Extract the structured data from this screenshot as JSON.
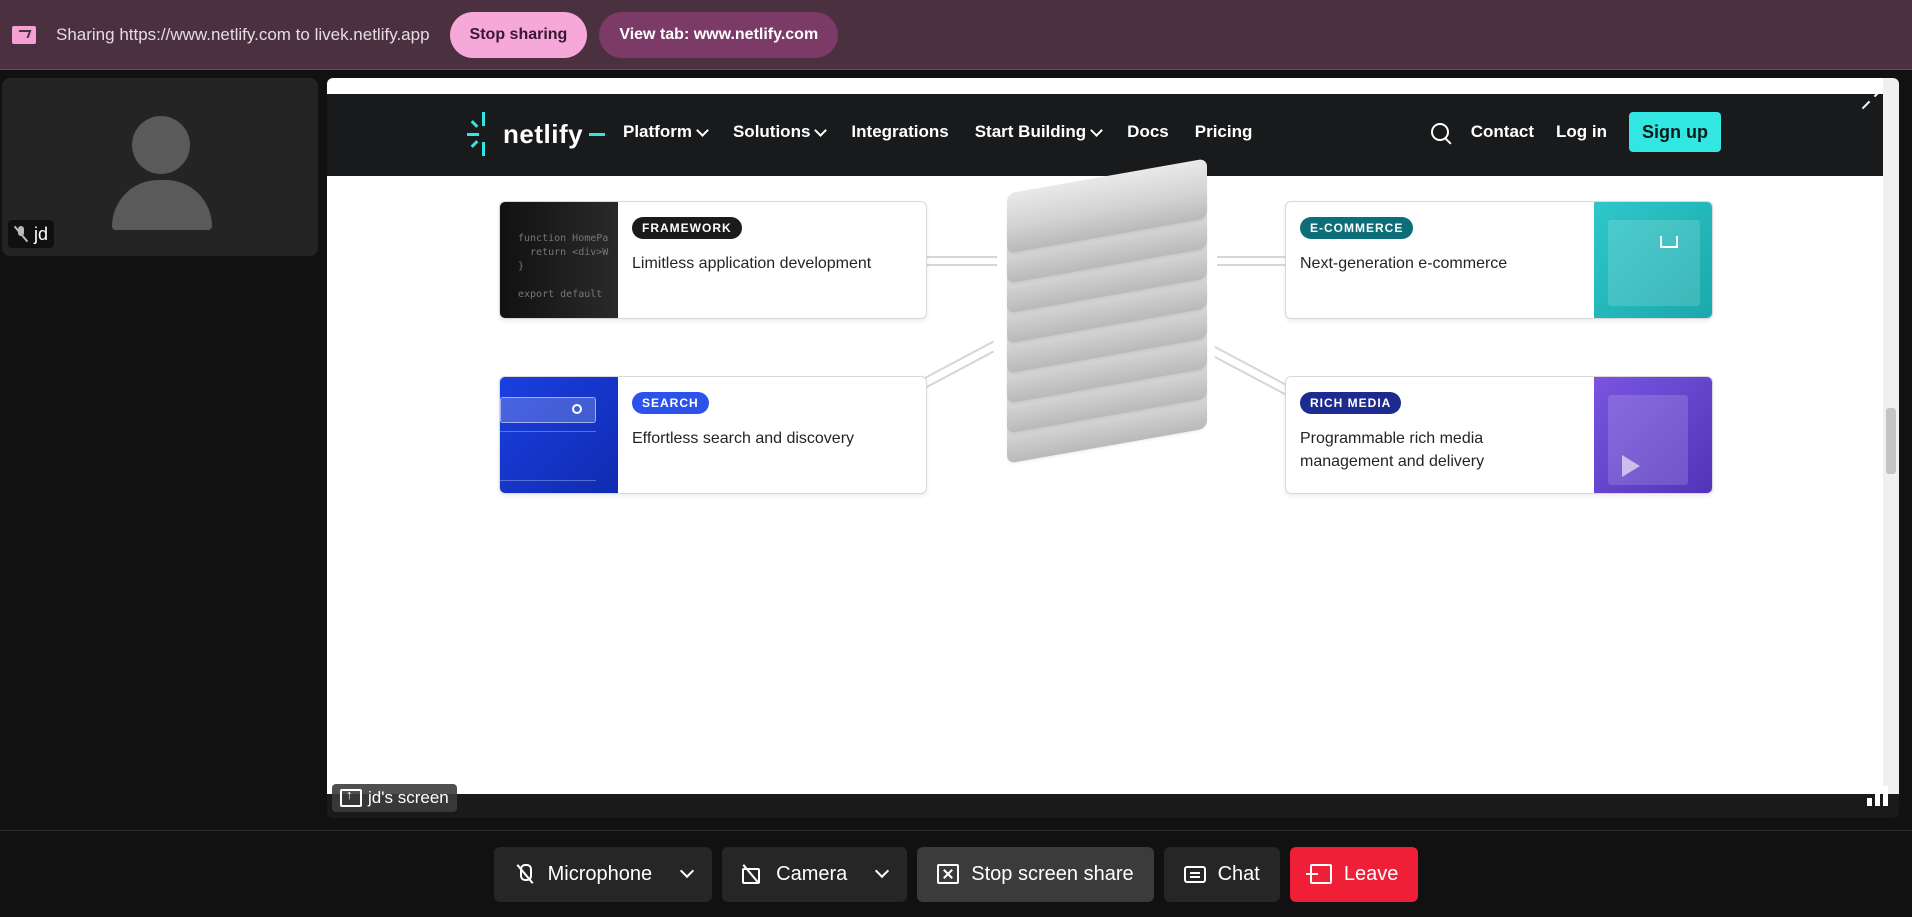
{
  "sharebar": {
    "message": "Sharing https://www.netlify.com to livek.netlify.app",
    "stop_label": "Stop sharing",
    "view_label": "View tab: www.netlify.com"
  },
  "participant": {
    "name": "jd",
    "mic_muted": true
  },
  "stage": {
    "screen_label": "jd's screen"
  },
  "site": {
    "brand": "netlify",
    "nav": [
      {
        "label": "Platform",
        "has_menu": true
      },
      {
        "label": "Solutions",
        "has_menu": true
      },
      {
        "label": "Integrations",
        "has_menu": false
      },
      {
        "label": "Start Building",
        "has_menu": true
      },
      {
        "label": "Docs",
        "has_menu": false
      },
      {
        "label": "Pricing",
        "has_menu": false
      }
    ],
    "contact": "Contact",
    "login": "Log in",
    "signup": "Sign up",
    "accent": "#32e6e2",
    "cards": {
      "framework": {
        "pill": "FRAMEWORK",
        "title": "Limitless application development",
        "code": "function HomePa\n  return <div>W\n}\n\nexport default"
      },
      "ecommerce": {
        "pill": "E-COMMERCE",
        "title": "Next-generation e-commerce"
      },
      "search": {
        "pill": "SEARCH",
        "title": "Effortless search and discovery"
      },
      "richmedia": {
        "pill": "RICH MEDIA",
        "title": "Programmable rich media management and delivery"
      }
    }
  },
  "controls": {
    "microphone": "Microphone",
    "camera": "Camera",
    "stop_share": "Stop screen share",
    "chat": "Chat",
    "leave": "Leave",
    "leave_color": "#ef1f37"
  }
}
